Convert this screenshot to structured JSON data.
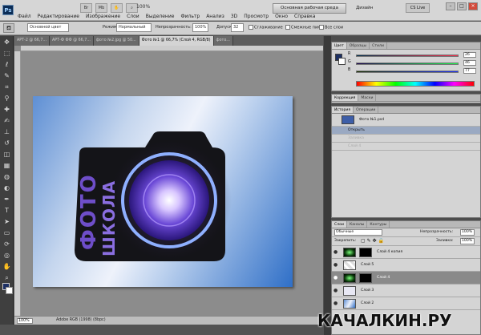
{
  "app": {
    "logo": "Ps"
  },
  "menu": [
    "Файл",
    "Редактирование",
    "Изображение",
    "Слои",
    "Выделение",
    "Фильтр",
    "Анализ",
    "3D",
    "Просмотр",
    "Окно",
    "Справка"
  ],
  "topbar": {
    "zoom": "100%",
    "workspace": "Основная рабочая среда",
    "design": "Дизайн",
    "cslive": "CS Live"
  },
  "options": {
    "preset": "Основной цвет",
    "mode_label": "Режим:",
    "mode_value": "Нормальный",
    "opacity_label": "Непрозрачность:",
    "opacity_value": "100%",
    "tolerance_label": "Допуск:",
    "tolerance_value": "32",
    "antialias": "Сглаживание",
    "contiguous": "Смежные пикс.",
    "all_layers": "Все слои"
  },
  "doc_tabs": [
    "АРТ-2 @ 66,7...",
    "АРТ-Ф ФФ @ 66,7...",
    "фото №2.jpg @ 50...",
    "Фото №1 @ 66,7% (Слой 4, RGB/8)",
    "фото..."
  ],
  "canvas": {
    "camera_text_left": "ФОТО",
    "camera_text_right": "ШКОЛА",
    "colors": {
      "camera": "#141418",
      "lens": "#4b2dbf",
      "text": "#6e4ec9"
    }
  },
  "status": {
    "zoom": "100%",
    "info": "Adobe RGB (1998) (8bpc)"
  },
  "color_panel": {
    "tabs": [
      "Цвет",
      "Образцы",
      "Стили"
    ],
    "sliders": [
      {
        "label": "R",
        "value": "26"
      },
      {
        "label": "G",
        "value": "46"
      },
      {
        "label": "B",
        "value": "77"
      }
    ]
  },
  "adjust_panel": {
    "tabs": [
      "Коррекция",
      "Маски"
    ]
  },
  "history_panel": {
    "tabs": [
      "История",
      "Операции"
    ],
    "items": [
      "Фото №1.psd",
      "Открыть",
      "Заливка",
      "Слой 4"
    ]
  },
  "layers_panel": {
    "tabs": [
      "Слои",
      "Каналы",
      "Контуры"
    ],
    "blend": "Обычные",
    "opacity_label": "Непрозрачность:",
    "opacity": "100%",
    "lock_label": "Закрепить:",
    "fill_label": "Заливка:",
    "fill": "100%",
    "layers": [
      {
        "name": "Слой 4 копия",
        "selected": false
      },
      {
        "name": "Слой 5",
        "selected": false
      },
      {
        "name": "Слой 4",
        "selected": true
      },
      {
        "name": "Слой 3",
        "selected": false
      },
      {
        "name": "Слой 2",
        "selected": false
      }
    ]
  },
  "watermark": "КАЧАЛКИН.РУ"
}
